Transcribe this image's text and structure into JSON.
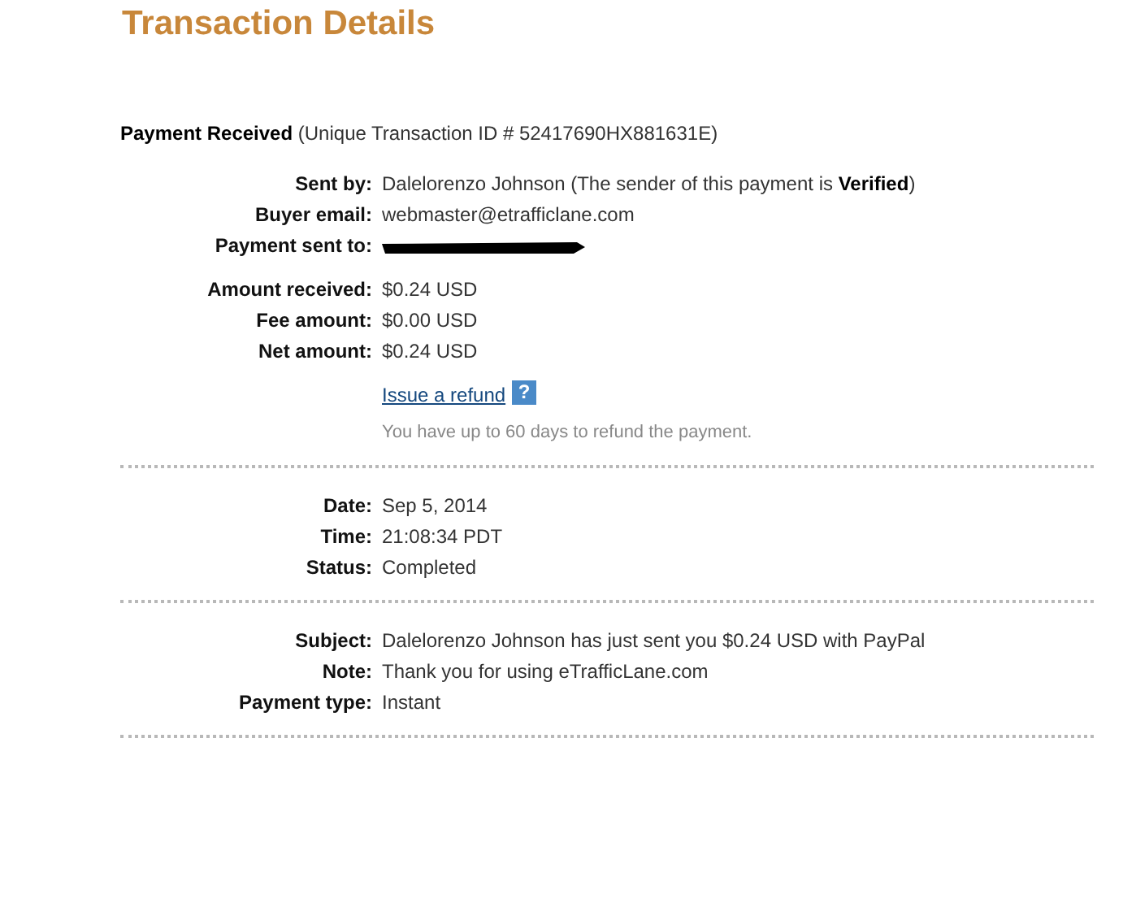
{
  "title": "Transaction Details",
  "header": "**Payment Received** (Unique Transaction ID # 52417690HX881631E)",
  "sections": [
    {
      "groups": [
        [
          {
            "kind": "text",
            "label": "Sent by:",
            "value": "Dalelorenzo Johnson (The sender of this payment is **Verified**)"
          },
          {
            "kind": "text",
            "label": "Buyer email:",
            "value": "webmaster@etrafficlane.com"
          },
          {
            "kind": "redacted",
            "label": "Payment sent to:"
          }
        ],
        [
          {
            "kind": "text",
            "label": "Amount received:",
            "value": "$0.24 USD"
          },
          {
            "kind": "text",
            "label": "Fee amount:",
            "value": "$0.00 USD"
          },
          {
            "kind": "text",
            "label": "Net amount:",
            "value": "$0.24 USD"
          }
        ],
        [
          {
            "kind": "link",
            "value": "Issue a refund",
            "help": "?"
          },
          {
            "kind": "note",
            "value": "You have up to 60 days to refund the payment."
          }
        ]
      ]
    },
    {
      "groups": [
        [
          {
            "kind": "text",
            "label": "Date:",
            "value": "Sep 5, 2014"
          },
          {
            "kind": "text",
            "label": "Time:",
            "value": "21:08:34 PDT"
          },
          {
            "kind": "text",
            "label": "Status:",
            "value": "Completed"
          }
        ]
      ]
    },
    {
      "groups": [
        [
          {
            "kind": "text",
            "label": "Subject:",
            "value": "Dalelorenzo Johnson has just sent you $0.24 USD with PayPal"
          },
          {
            "kind": "text",
            "label": "Note:",
            "value": "Thank you for using eTrafficLane.com"
          },
          {
            "kind": "text",
            "label": "Payment type:",
            "value": "Instant"
          }
        ]
      ]
    }
  ]
}
